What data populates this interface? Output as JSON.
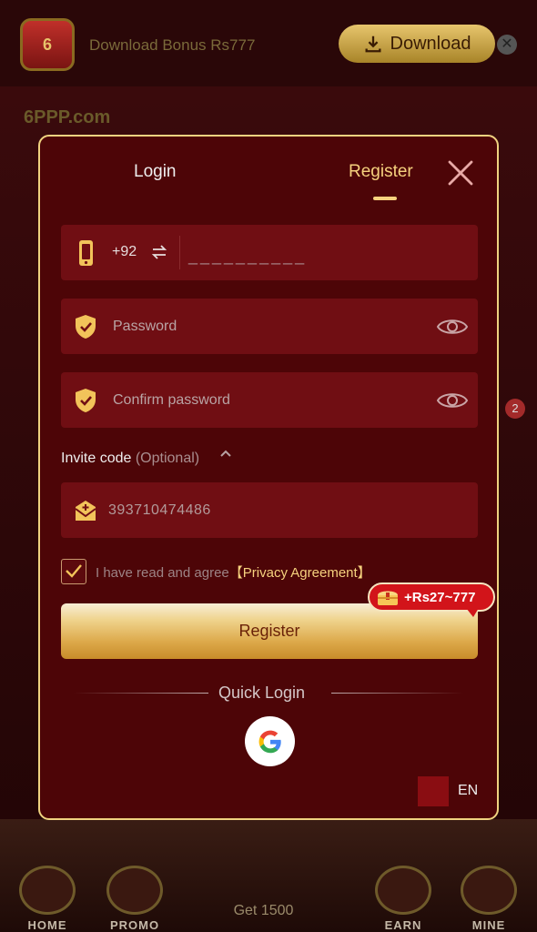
{
  "background": {
    "bonus_text": "Download Bonus Rs777",
    "download_label": "Download",
    "logo_text": "6PPP.com",
    "badge_count": "2",
    "nav": {
      "home": "HOME",
      "promo": "PROMO",
      "get": "Get 1500",
      "earn": "EARN",
      "mine": "MINE"
    }
  },
  "modal": {
    "tabs": {
      "login": "Login",
      "register": "Register",
      "active": "register"
    },
    "phone": {
      "country_code": "+92",
      "placeholder": "__________"
    },
    "password": {
      "placeholder": "Password"
    },
    "confirm_password": {
      "placeholder": "Confirm password"
    },
    "invite": {
      "label": "Invite code",
      "optional": "(Optional)",
      "value": "393710474486"
    },
    "agreement": {
      "checked": true,
      "text": "I have read and agree",
      "link": "【Privacy Agreement】"
    },
    "register_button": "Register",
    "bonus_badge": "+Rs27~777",
    "quick_login": "Quick Login",
    "language": "EN"
  },
  "colors": {
    "modal_bg": "#4d0507",
    "field_bg": "#700e13",
    "accent_gold": "#f6d27e",
    "badge_red": "#d2141a"
  }
}
